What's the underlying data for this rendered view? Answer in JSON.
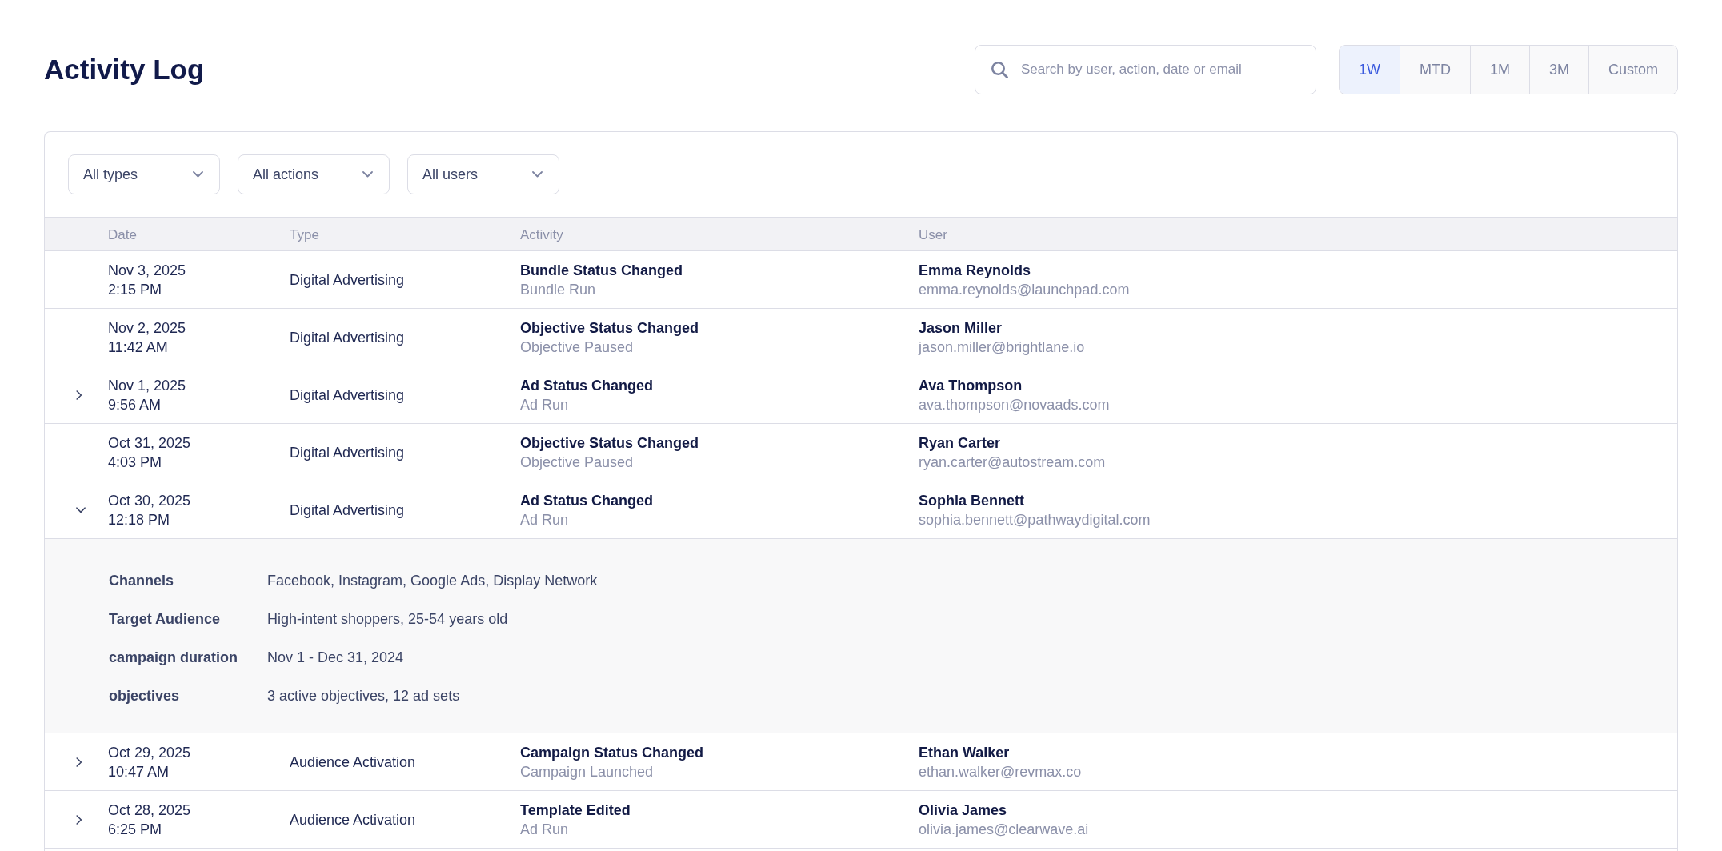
{
  "page": {
    "title": "Activity Log"
  },
  "search": {
    "placeholder": "Search by user, action, date or email"
  },
  "time_ranges": [
    {
      "label": "1W",
      "selected": true
    },
    {
      "label": "MTD",
      "selected": false
    },
    {
      "label": "1M",
      "selected": false
    },
    {
      "label": "3M",
      "selected": false
    },
    {
      "label": "Custom",
      "selected": false
    }
  ],
  "filters": [
    {
      "label": "All types"
    },
    {
      "label": "All actions"
    },
    {
      "label": "All users"
    }
  ],
  "table": {
    "columns": [
      "Date",
      "Type",
      "Activity",
      "User"
    ],
    "rows": [
      {
        "date": "Nov 3, 2025",
        "time": "2:15 PM",
        "type": "Digital Advertising",
        "activity": "Bundle Status Changed",
        "activity_detail": "Bundle Run",
        "user": "Emma Reynolds",
        "email": "emma.reynolds@launchpad.com",
        "expandable": false,
        "expanded": false
      },
      {
        "date": "Nov 2, 2025",
        "time": "11:42 AM",
        "type": "Digital Advertising",
        "activity": "Objective Status Changed",
        "activity_detail": "Objective Paused",
        "user": "Jason Miller",
        "email": "jason.miller@brightlane.io",
        "expandable": false,
        "expanded": false
      },
      {
        "date": "Nov 1, 2025",
        "time": "9:56 AM",
        "type": "Digital Advertising",
        "activity": "Ad Status Changed",
        "activity_detail": "Ad Run",
        "user": "Ava Thompson",
        "email": "ava.thompson@novaads.com",
        "expandable": true,
        "expanded": false
      },
      {
        "date": "Oct 31, 2025",
        "time": "4:03 PM",
        "type": "Digital Advertising",
        "activity": "Objective Status Changed",
        "activity_detail": "Objective Paused",
        "user": "Ryan Carter",
        "email": "ryan.carter@autostream.com",
        "expandable": false,
        "expanded": false
      },
      {
        "date": "Oct 30, 2025",
        "time": "12:18 PM",
        "type": "Digital Advertising",
        "activity": "Ad Status Changed",
        "activity_detail": "Ad Run",
        "user": "Sophia Bennett",
        "email": "sophia.bennett@pathwaydigital.com",
        "expandable": true,
        "expanded": true,
        "details": [
          {
            "label": "Channels",
            "value": "Facebook, Instagram, Google Ads, Display Network"
          },
          {
            "label": "Target Audience",
            "value": "High-intent shoppers, 25-54 years old"
          },
          {
            "label": "campaign duration",
            "value": "Nov 1 - Dec 31, 2024"
          },
          {
            "label": "objectives",
            "value": "3 active objectives, 12 ad sets"
          }
        ]
      },
      {
        "date": "Oct 29, 2025",
        "time": "10:47 AM",
        "type": "Audience Activation",
        "activity": "Campaign Status Changed",
        "activity_detail": "Campaign Launched",
        "user": "Ethan Walker",
        "email": "ethan.walker@revmax.co",
        "expandable": true,
        "expanded": false
      },
      {
        "date": "Oct 28, 2025",
        "time": "6:25 PM",
        "type": "Audience Activation",
        "activity": "Template Edited",
        "activity_detail": "Ad Run",
        "user": "Olivia James",
        "email": "olivia.james@clearwave.ai",
        "expandable": true,
        "expanded": false
      }
    ]
  }
}
